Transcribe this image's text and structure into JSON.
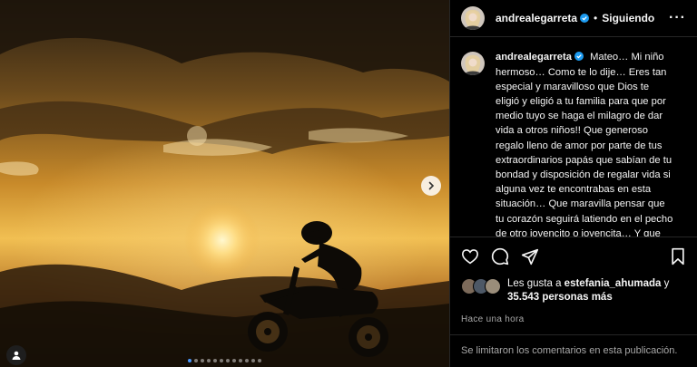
{
  "post": {
    "username": "andrealegarreta",
    "separator": "•",
    "follow_status": "Siguiendo",
    "more_icon": "···",
    "caption_username": "andrealegarreta",
    "caption_text": "Mateo… Mi niño hermoso… Como te lo dije… Eres tan especial y maravilloso que Dios te eligió y eligió a tu familia para que por medio tuyo se haga el milagro de dar vida a otros niños!! Que generoso regalo lleno de amor por parte de tus extraordinarios papás que sabían de tu bondad y disposición de regalar vida si alguna vez te encontrabas en esta situación… Que maravilla pensar que tu corazón seguirá latiendo en el pecho de otro jovencito o jovencita… Y que cada uno de tus órganos",
    "likes_prefix": "Les gusta a",
    "likes_user": "estefania_ahumada",
    "likes_and": "y",
    "likes_count": "35.543 personas más",
    "timestamp": "Hace una hora",
    "comments_disabled": "Se limitaron los comentarios en esta publicación."
  },
  "media": {
    "carousel_count": 12,
    "active_index": 0,
    "icons": [
      "chevron-right-icon",
      "user-tag-icon"
    ]
  },
  "colors": {
    "accent": "#4c9aff",
    "verified": "#1d9bf0",
    "divider": "#262626",
    "muted": "#a8a8a8"
  }
}
